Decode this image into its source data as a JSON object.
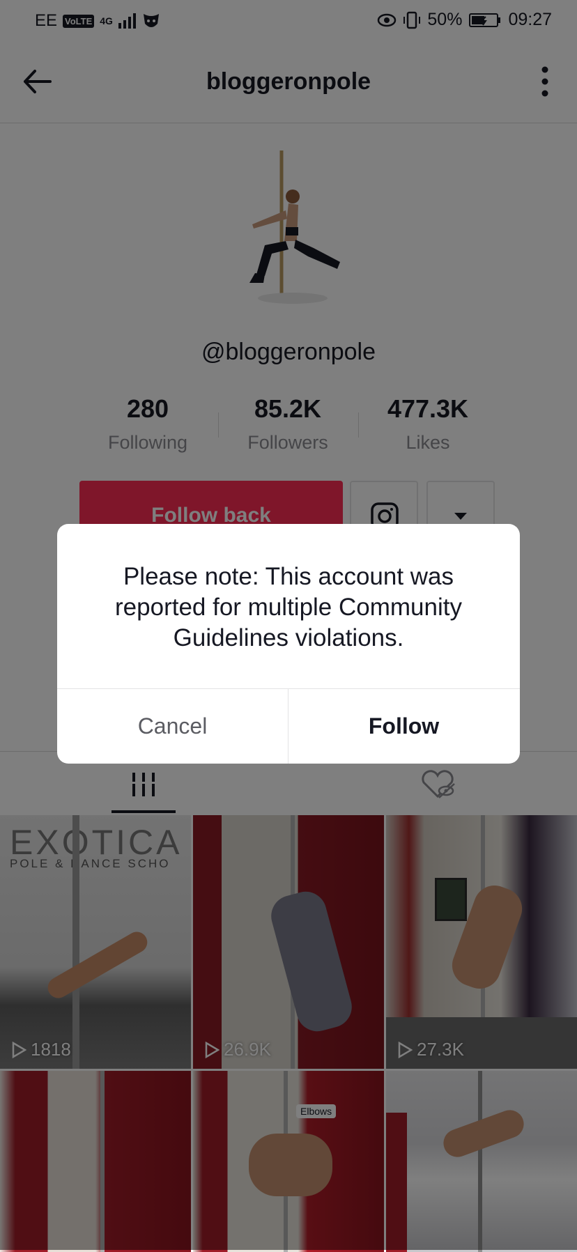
{
  "status_bar": {
    "carrier": "EE",
    "volte": "VoLTE",
    "network": "4G",
    "battery": "50%",
    "time": "09:27"
  },
  "header": {
    "title": "bloggeronpole",
    "back_icon": "arrow-left-icon",
    "more_icon": "more-vertical-icon"
  },
  "profile": {
    "handle": "@bloggeronpole",
    "stats": [
      {
        "value": "280",
        "label": "Following"
      },
      {
        "value": "85.2K",
        "label": "Followers"
      },
      {
        "value": "477.3K",
        "label": "Likes"
      }
    ],
    "follow_back_label": "Follow back",
    "accent_color": "#fe2c55"
  },
  "tabs": [
    {
      "icon": "grid-icon",
      "active": true
    },
    {
      "icon": "liked-hidden-icon",
      "active": false
    }
  ],
  "videos": [
    {
      "views": "1818",
      "overlay_text": "POLE & DANCE SCHO"
    },
    {
      "views": "26.9K"
    },
    {
      "views": "27.3K"
    },
    {
      "views": ""
    },
    {
      "views": "",
      "overlay_text": "Elbows"
    },
    {
      "views": ""
    }
  ],
  "dialog": {
    "message": "Please note: This account was reported for multiple Community Guidelines violations.",
    "cancel_label": "Cancel",
    "follow_label": "Follow"
  }
}
